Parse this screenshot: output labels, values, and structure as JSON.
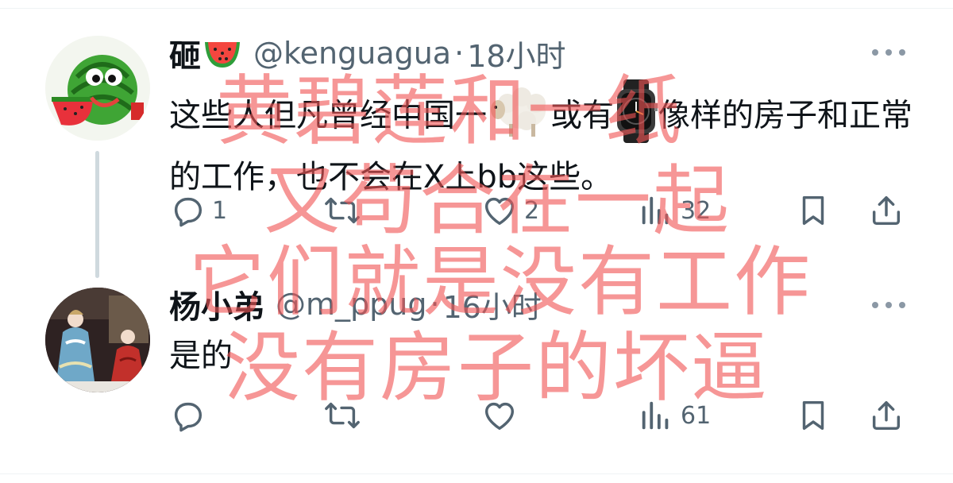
{
  "thread": [
    {
      "author": {
        "name": "砸",
        "name_emoji": "watermelon-emoji-icon",
        "handle": "@kenguagua",
        "separator": "·",
        "time": "18小时",
        "avatar": "watermelon-avatar"
      },
      "text_parts": [
        "这些人但凡曾经中国一",
        "sheep-emoji-icon",
        "或有",
        "watch-emoji-icon",
        "像样的房子和正常的工作，也不会在X上bb这些。"
      ],
      "text_segments": {
        "before_sheep": "这些人但凡曾经中国一",
        "middle": "或有",
        "after_watch": "像样的房子和正常的工作，也不会在X上bb这些。"
      },
      "actions": {
        "reply_count": "1",
        "retweet_count": "",
        "like_count": "2",
        "view_count": "32"
      }
    },
    {
      "author": {
        "name": "杨小弟",
        "handle": "@m_ppug",
        "separator": "·",
        "time": "16小时",
        "avatar": "porcelain-figurines-avatar"
      },
      "text": "是的",
      "actions": {
        "reply_count": "",
        "retweet_count": "",
        "like_count": "",
        "view_count": "61"
      }
    }
  ],
  "overlay_text": [
    "黄碧莲和一纸",
    "又苟合在一起",
    "它们就是没有工作",
    "没有房子的坏逼"
  ],
  "colors": {
    "overlay": "#f05656",
    "secondary_text": "#536471",
    "primary_text": "#0f1419",
    "thread_line": "#cfd9de"
  }
}
